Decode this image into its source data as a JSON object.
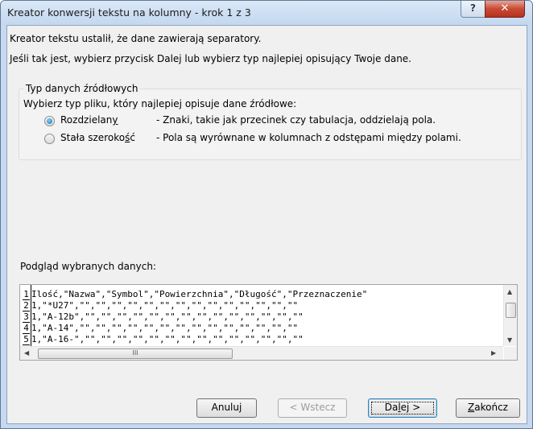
{
  "window": {
    "title": "Kreator konwersji tekstu na kolumny - krok 1 z 3",
    "help_label": "?",
    "close_label": "✕"
  },
  "intro": {
    "line1": "Kreator tekstu ustalił, że dane zawierają separatory.",
    "line2": "Jeśli tak jest, wybierz przycisk Dalej lub wybierz typ najlepiej opisujący Twoje dane."
  },
  "data_type_group": {
    "title": "Typ danych źródłowych",
    "prompt": "Wybierz typ pliku, który najlepiej opisuje dane źródłowe:",
    "options": [
      {
        "label_main": "Rozdzielan",
        "label_accel": "y",
        "description": "- Znaki, takie jak przecinek czy tabulacja, oddzielają pola.",
        "selected": true
      },
      {
        "label_main": "Stała szeroko",
        "label_accel": "ś",
        "label_tail": "ć",
        "description": "- Pola są wyrównane w kolumnach z odstępami między polami.",
        "selected": false
      }
    ]
  },
  "preview": {
    "label": "Podgląd wybranych danych:",
    "rows": [
      {
        "num": "1",
        "text": "Ilość,\"Nazwa\",\"Symbol\",\"Powierzchnia\",\"Długość\",\"Przeznaczenie\""
      },
      {
        "num": "2",
        "text": "1,\"*U27\",\"\",\"\",\"\",\"\",\"\",\"\",\"\",\"\",\"\",\"\",\"\",\"\",\"\",\"\""
      },
      {
        "num": "3",
        "text": "1,\"A-12b\",\"\",\"\",\"\",\"\",\"\",\"\",\"\",\"\",\"\",\"\",\"\",\"\",\"\",\"\""
      },
      {
        "num": "4",
        "text": "1,\"A-14\",\"\",\"\",\"\",\"\",\"\",\"\",\"\",\"\",\"\",\"\",\"\",\"\",\"\",\"\""
      },
      {
        "num": "5",
        "text": "1,\"A-16-\",\"\",\"\",\"\",\"\",\"\",\"\",\"\",\"\",\"\",\"\",\"\",\"\",\"\",\"\""
      }
    ],
    "hthumb_grip": "III"
  },
  "buttons": {
    "cancel": "Anuluj",
    "back": "< Wstecz",
    "next_pre": "Da",
    "next_accel": "l",
    "next_post": "ej >",
    "finish_accel": "Z",
    "finish_post": "akończ"
  }
}
